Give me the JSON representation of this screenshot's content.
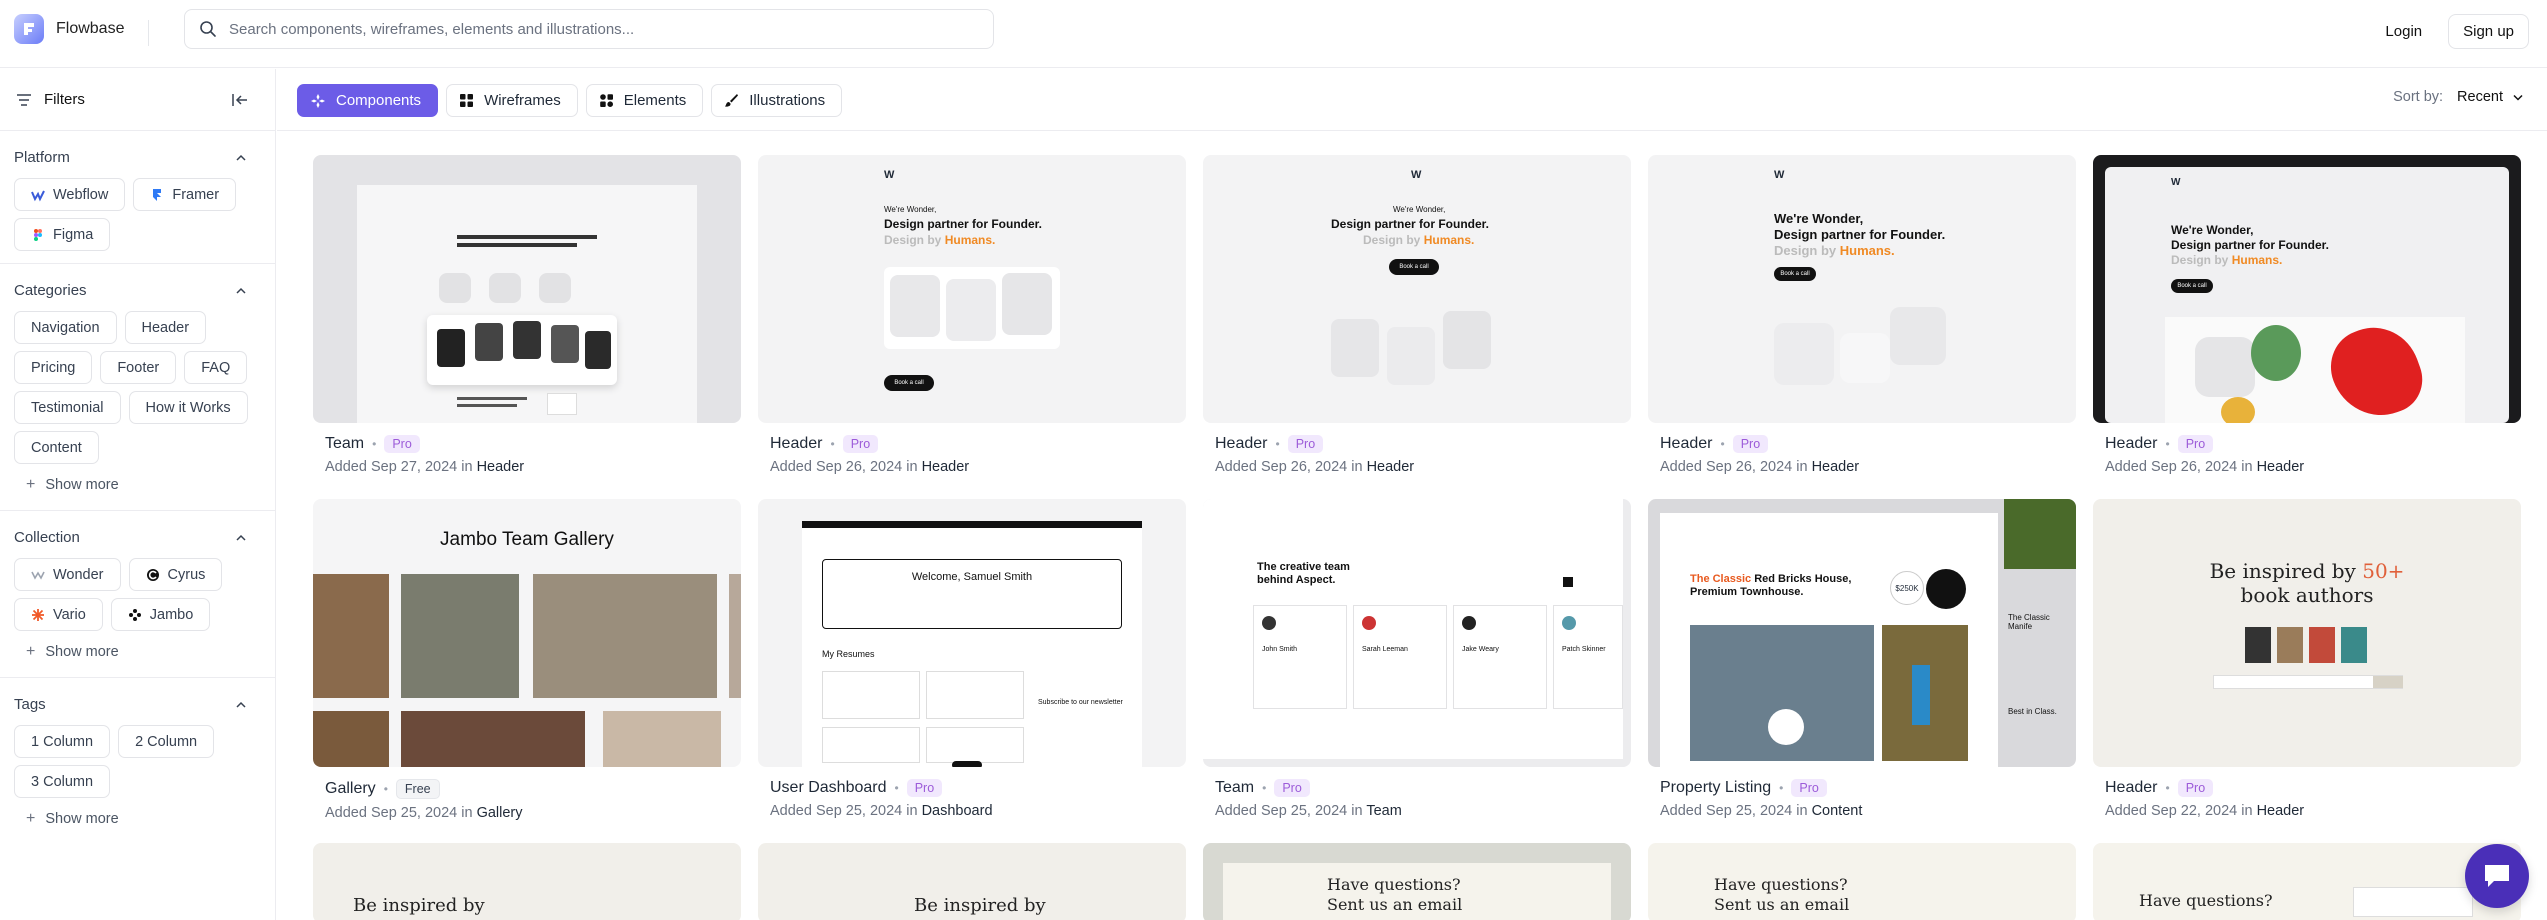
{
  "header": {
    "brand": "Flowbase",
    "search_placeholder": "Search components, wireframes, elements and illustrations...",
    "login": "Login",
    "signup": "Sign up"
  },
  "sidebar": {
    "filters_label": "Filters",
    "sections": [
      {
        "title": "Platform",
        "items": [
          "Webflow",
          "Framer",
          "Figma"
        ]
      },
      {
        "title": "Categories",
        "items": [
          "Navigation",
          "Header",
          "Pricing",
          "Footer",
          "FAQ",
          "Testimonial",
          "How it Works",
          "Content"
        ],
        "show_more": "Show more"
      },
      {
        "title": "Collection",
        "items": [
          "Wonder",
          "Cyrus",
          "Vario",
          "Jambo"
        ],
        "show_more": "Show more"
      },
      {
        "title": "Tags",
        "items": [
          "1 Column",
          "2 Column",
          "3 Column"
        ],
        "show_more": "Show more"
      }
    ]
  },
  "tabs": [
    {
      "label": "Components",
      "active": true
    },
    {
      "label": "Wireframes",
      "active": false
    },
    {
      "label": "Elements",
      "active": false
    },
    {
      "label": "Illustrations",
      "active": false
    }
  ],
  "sort": {
    "label": "Sort by:",
    "value": "Recent"
  },
  "cards": [
    {
      "title": "Team",
      "badge": "Pro",
      "added": "Added Sep 27, 2024 in",
      "category": "Header"
    },
    {
      "title": "Header",
      "badge": "Pro",
      "added": "Added Sep 26, 2024 in",
      "category": "Header"
    },
    {
      "title": "Header",
      "badge": "Pro",
      "added": "Added Sep 26, 2024 in",
      "category": "Header"
    },
    {
      "title": "Header",
      "badge": "Pro",
      "added": "Added Sep 26, 2024 in",
      "category": "Header"
    },
    {
      "title": "Header",
      "badge": "Pro",
      "added": "Added Sep 26, 2024 in",
      "category": "Header"
    },
    {
      "title": "Gallery",
      "badge": "Free",
      "added": "Added Sep 25, 2024 in",
      "category": "Gallery"
    },
    {
      "title": "User Dashboard",
      "badge": "Pro",
      "added": "Added Sep 25, 2024 in",
      "category": "Dashboard"
    },
    {
      "title": "Team",
      "badge": "Pro",
      "added": "Added Sep 25, 2024 in",
      "category": "Team"
    },
    {
      "title": "Property Listing",
      "badge": "Pro",
      "added": "Added Sep 25, 2024 in",
      "category": "Content"
    },
    {
      "title": "Header",
      "badge": "Pro",
      "added": "Added Sep 22, 2024 in",
      "category": "Header"
    }
  ],
  "thumbs": {
    "wonder_headline_1": "Design partner for Founder.",
    "wonder_headline_2": "Design by",
    "wonder_accent": "Humans.",
    "wonder_small": "We're Wonder,",
    "wonder_cta": "Book a call",
    "jambo_title": "Jambo Team Gallery",
    "dashboard_welcome": "Welcome, Samuel Smith",
    "dashboard_resumes": "My Resumes",
    "dashboard_subscribe": "Subscribe to our newsletter",
    "team_title": "The creative team behind Aspect.",
    "team_names": [
      "John Smith",
      "Sarah Leeman",
      "Jake Weary",
      "Patch Skinner"
    ],
    "property_title_accent": "The Classic",
    "property_title": "Red Bricks House, Premium Townhouse.",
    "property_price": "$250K",
    "property_side": "The Classic Manife",
    "property_best": "Best in Class.",
    "books_title": "Be inspired by",
    "books_num": "50+",
    "books_title2": "book authors",
    "books_inspired": "Be inspired by",
    "questions": "Have questions?",
    "questions2": "Sent us an email"
  },
  "colors": {
    "accent": "#6c5ce7",
    "pro_badge": "#9c5bd9",
    "orange": "#f08a24"
  }
}
